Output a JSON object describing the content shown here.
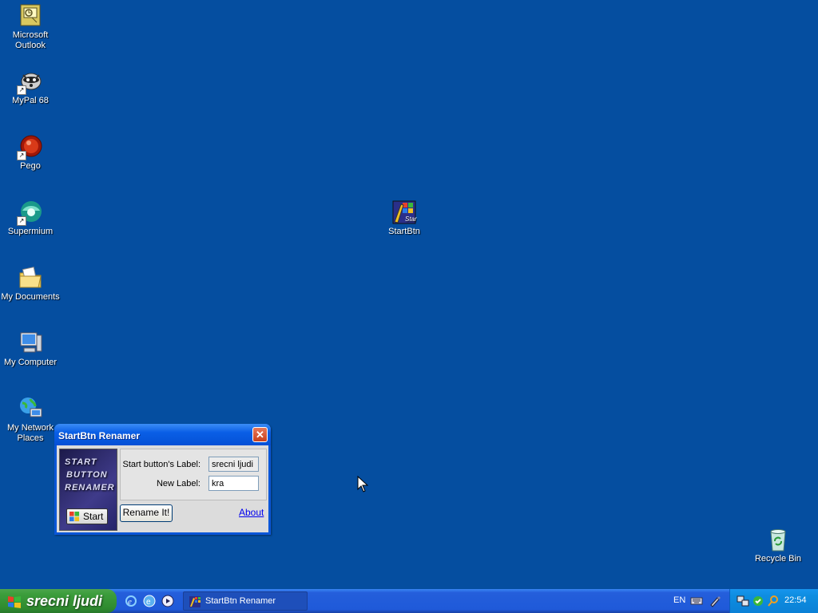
{
  "desktop": {
    "icons": [
      {
        "label": "Microsoft Outlook",
        "icon": "outlook-icon"
      },
      {
        "label": "MyPal 68",
        "icon": "mypal-icon"
      },
      {
        "label": "Pego",
        "icon": "pego-icon"
      },
      {
        "label": "Supermium",
        "icon": "supermium-icon"
      },
      {
        "label": "My Documents",
        "icon": "folder-icon"
      },
      {
        "label": "My Computer",
        "icon": "computer-icon"
      },
      {
        "label": "My Network Places",
        "icon": "network-icon"
      },
      {
        "label": "StartBtn",
        "icon": "startbtn-icon"
      },
      {
        "label": "Recycle Bin",
        "icon": "recycle-bin-icon"
      }
    ]
  },
  "window": {
    "title": "StartBtn Renamer",
    "close_glyph": "✕",
    "logo_lines": [
      "START",
      "BUTTON",
      "RENAMER"
    ],
    "logo_button_label": "Start",
    "current_label_caption": "Start button's Label:",
    "current_label_value": "srecni ljudi",
    "new_label_caption": "New Label:",
    "new_label_value": "kra",
    "rename_button": "Rename It!",
    "about_link": "About"
  },
  "taskbar": {
    "start_label": "srecni ljudi",
    "quick_launch": [
      "internet-explorer-icon",
      "outlook-express-icon",
      "media-player-icon"
    ],
    "task_button": "StartBtn Renamer",
    "language": "EN",
    "tray_icons": [
      "keyboard-icon",
      "pen-icon",
      "network-tray-icon",
      "update-tray-icon",
      "search-tray-icon"
    ],
    "clock": "22:54"
  },
  "colors": {
    "desktop_background": "#054ea0",
    "taskbar": "#245edb",
    "start_button": "#3c9e3c",
    "title_bar": "#0a5fe6"
  }
}
